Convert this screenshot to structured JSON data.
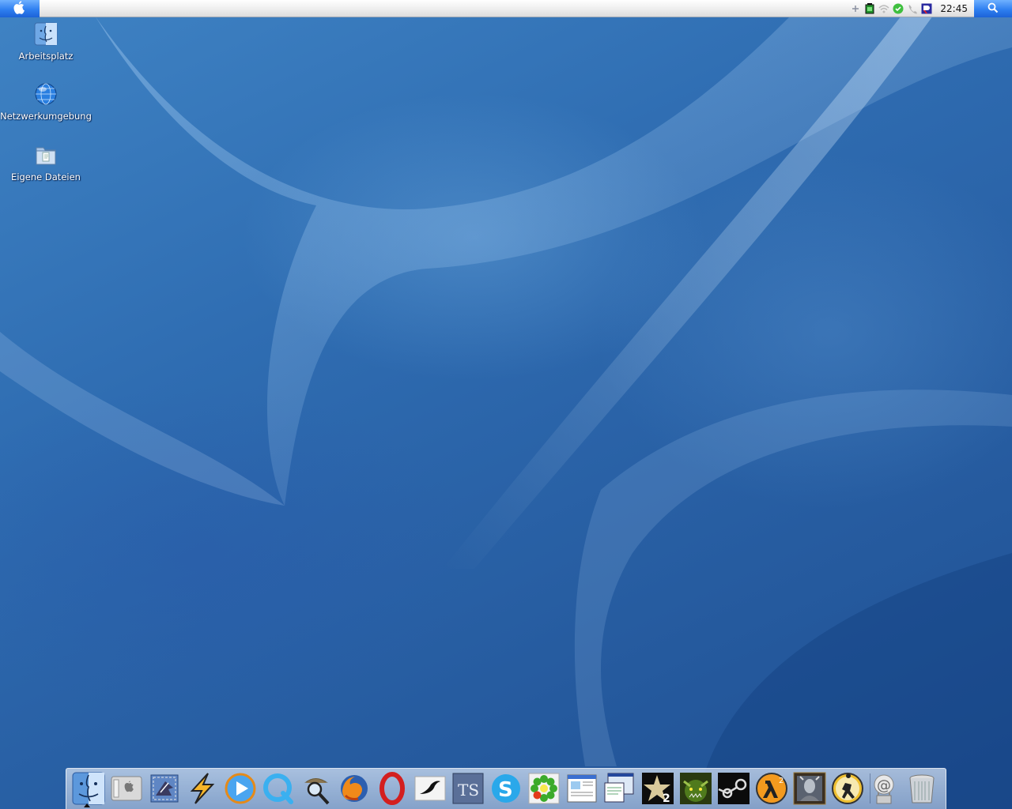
{
  "menubar": {
    "clock": "22:45",
    "tray_icons": [
      "plus-icon",
      "battery-icon",
      "wifi-icon",
      "messenger-icon",
      "phone-icon",
      "network-monitor-icon"
    ]
  },
  "desktop": {
    "icons": [
      {
        "label": "Arbeitsplatz",
        "icon": "finder-icon"
      },
      {
        "label": "Netzwerkumgebung",
        "icon": "network-globe-icon"
      },
      {
        "label": "Eigene Dateien",
        "icon": "folder-icon"
      }
    ]
  },
  "dock": {
    "apps": [
      "finder-icon",
      "system-preferences-icon",
      "mail-icon",
      "winamp-icon",
      "media-player-icon",
      "quicktime-icon",
      "sherlock-icon",
      "firefox-icon",
      "opera-icon",
      "xfire-icon",
      "teamspeak-icon",
      "skype-icon",
      "icq-icon",
      "document-viewer-icon",
      "network-viewer-icon",
      "game-star2-icon",
      "warcraft-icon",
      "steam-icon",
      "half-life2-icon",
      "game-portrait-icon",
      "counter-strike-icon"
    ],
    "right_apps": [
      "internet-connect-icon",
      "trash-icon"
    ]
  },
  "colors": {
    "accent": "#2f7ff0",
    "desktop": "#2f6db2"
  }
}
